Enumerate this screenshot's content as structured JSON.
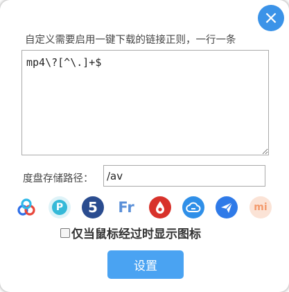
{
  "dialog": {
    "close_glyph": "×",
    "prompt": "自定义需要启用一键下载的链接正则，一行一条",
    "regex_value": "mp4\\?[^\\.]+$",
    "path_label": "度盘存储路径：",
    "path_value": "/av",
    "hover_label": "仅当鼠标经过时显示图标",
    "hover_checked": false,
    "submit_label": "设置"
  },
  "icons": [
    {
      "name": "baidu-pan-icon",
      "color": "#2f6fe8"
    },
    {
      "name": "pikpak-icon",
      "color": "#35b9d8",
      "glyph": "P"
    },
    {
      "name": "five-icon",
      "color": "#2a4c8f",
      "glyph": "5"
    },
    {
      "name": "fr-icon",
      "color": "#5a8fd8",
      "glyph": "Fr"
    },
    {
      "name": "red-drop-icon",
      "color": "#e0342c"
    },
    {
      "name": "cloud-sync-icon",
      "color": "#2f8fe8"
    },
    {
      "name": "paper-plane-icon",
      "color": "#2f7ae8"
    },
    {
      "name": "mi-icon",
      "color": "#f6a37a",
      "glyph": "mi"
    }
  ]
}
